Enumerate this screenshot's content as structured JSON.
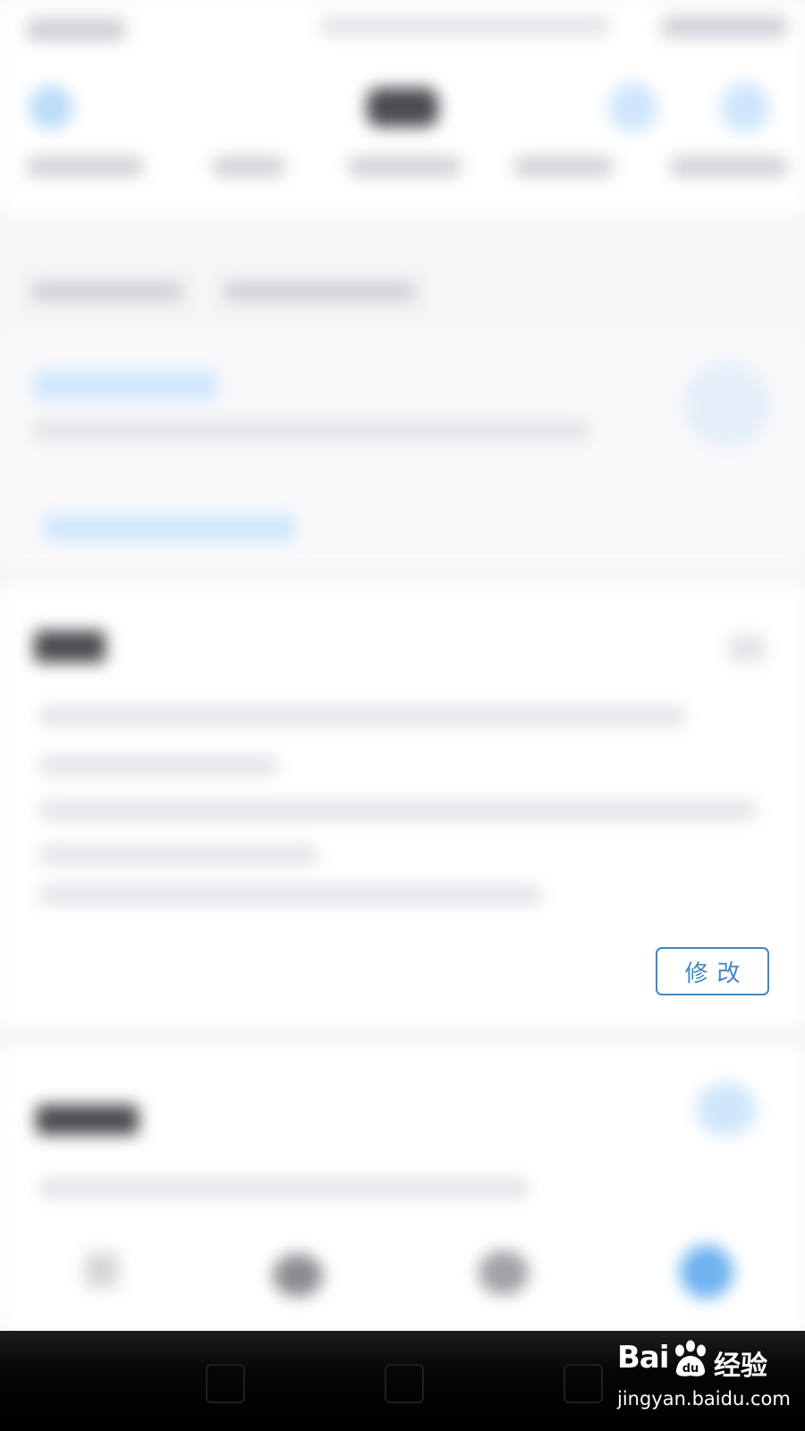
{
  "edit_button": {
    "label": "修改",
    "color": "#3f87c8"
  },
  "watermark": {
    "brand_latin": "Bai",
    "brand_cn": "经验",
    "url": "jingyan.baidu.com"
  },
  "icons": [
    "paw-icon",
    "back-key-icon",
    "home-key-icon",
    "recent-key-icon"
  ],
  "colors": {
    "background": "#f6f6f8",
    "card": "#ffffff",
    "accent": "#3f87c8",
    "nav_bar": "#000000"
  }
}
